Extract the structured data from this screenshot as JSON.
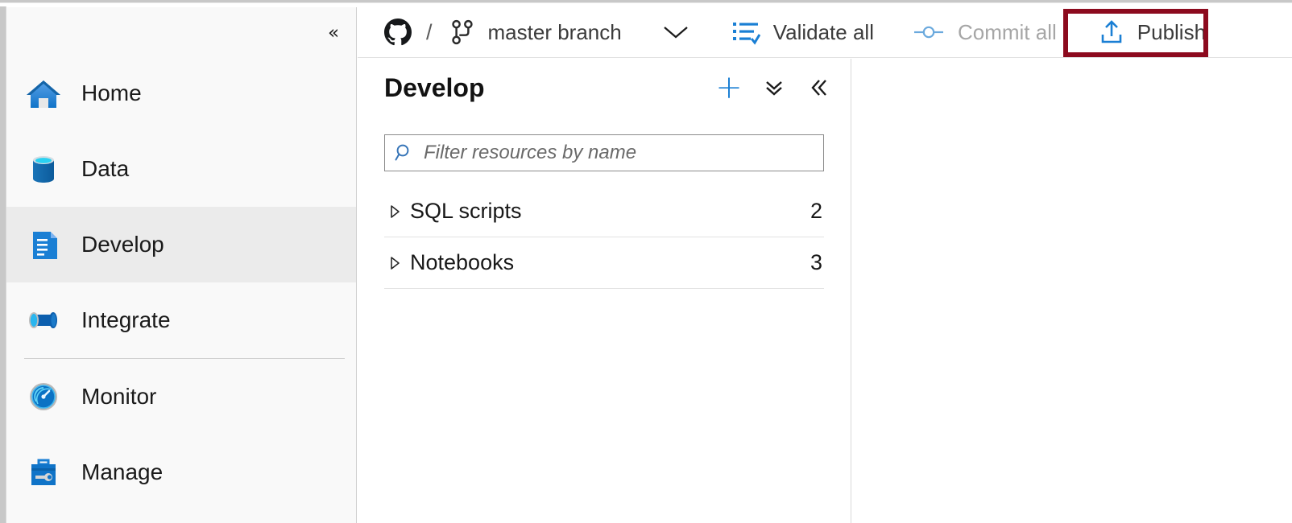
{
  "toolbar": {
    "repo_icon": "github-icon",
    "separator": "/",
    "branch_icon": "git-branch-icon",
    "branch_label": "master branch",
    "branch_dropdown_icon": "chevron-down-icon",
    "validate_icon": "validate-list-check-icon",
    "validate_label": "Validate all",
    "commit_icon": "commit-node-icon",
    "commit_label": "Commit all",
    "publish_icon": "publish-upload-icon",
    "publish_label": "Publish",
    "highlight_color": "#8c0a1e",
    "accent_color": "#1a7fd4",
    "disabled_color": "#a6a6a6"
  },
  "sidebar": {
    "collapse_icon": "chevron-double-left-icon",
    "items": [
      {
        "label": "Home",
        "icon": "home-icon",
        "selected": false,
        "divider_after": false
      },
      {
        "label": "Data",
        "icon": "database-icon",
        "selected": false,
        "divider_after": false
      },
      {
        "label": "Develop",
        "icon": "document-icon",
        "selected": true,
        "divider_after": false
      },
      {
        "label": "Integrate",
        "icon": "pipeline-icon",
        "selected": false,
        "divider_after": true
      },
      {
        "label": "Monitor",
        "icon": "gauge-icon",
        "selected": false,
        "divider_after": false
      },
      {
        "label": "Manage",
        "icon": "toolbox-icon",
        "selected": false,
        "divider_after": false
      }
    ]
  },
  "panel": {
    "title": "Develop",
    "add_icon": "plus-icon",
    "collapse_all_icon": "chevron-double-down-icon",
    "collapse_panel_icon": "chevron-double-left-icon",
    "search": {
      "icon": "search-icon",
      "placeholder": "Filter resources by name",
      "value": ""
    },
    "tree": [
      {
        "label": "SQL scripts",
        "count": "2",
        "caret": "caret-right-icon"
      },
      {
        "label": "Notebooks",
        "count": "3",
        "caret": "caret-right-icon"
      }
    ]
  }
}
